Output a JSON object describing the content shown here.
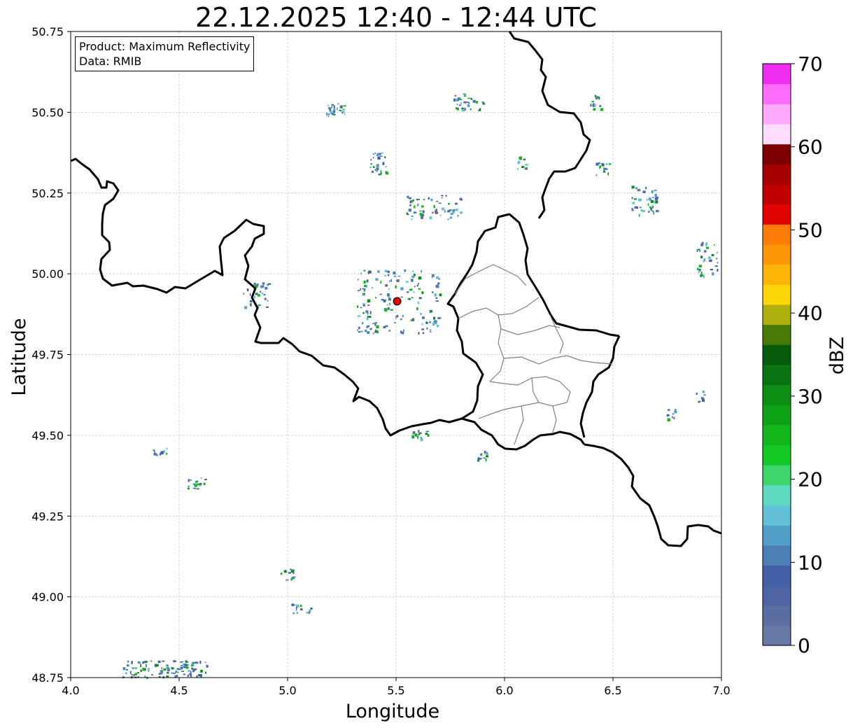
{
  "title": "22.12.2025 12:40 - 12:44 UTC",
  "info": {
    "product_line": "Product: Maximum Reflectivity",
    "data_line": "Data: RMIB"
  },
  "map": {
    "xlabel": "Longitude",
    "ylabel": "Latitude",
    "xlim": [
      4.0,
      7.0
    ],
    "ylim": [
      48.75,
      50.75
    ],
    "xticks": [
      "4.0",
      "4.5",
      "5.0",
      "5.5",
      "6.0",
      "6.5",
      "7.0"
    ],
    "yticks": [
      "48.75",
      "49.00",
      "49.25",
      "49.50",
      "49.75",
      "50.00",
      "50.25",
      "50.50",
      "50.75"
    ],
    "grid": true,
    "radar_site": {
      "lon": 5.505,
      "lat": 49.915
    },
    "colors": {
      "border": "#000000",
      "region_border": "#808080",
      "site": "#e00000"
    }
  },
  "colorbar": {
    "label": "dBZ",
    "ticks": [
      "0",
      "10",
      "20",
      "30",
      "40",
      "50",
      "60",
      "70"
    ],
    "range": [
      0,
      70
    ],
    "colors": [
      "#6777a6",
      "#5b6ea2",
      "#4e64a4",
      "#4360a7",
      "#4b7fb5",
      "#529fc7",
      "#63c0d9",
      "#5fd8c0",
      "#3cd66a",
      "#15c925",
      "#12b51b",
      "#0ea315",
      "#0c8d14",
      "#0a7312",
      "#075c0c",
      "#4a7a06",
      "#aeb00d",
      "#fcd607",
      "#fdb406",
      "#fd9607",
      "#fd7c07",
      "#e00300",
      "#c10000",
      "#a40000",
      "#7c0000",
      "#fddcfd",
      "#fdaafd",
      "#fd6cfb",
      "#ef2df0"
    ]
  }
}
